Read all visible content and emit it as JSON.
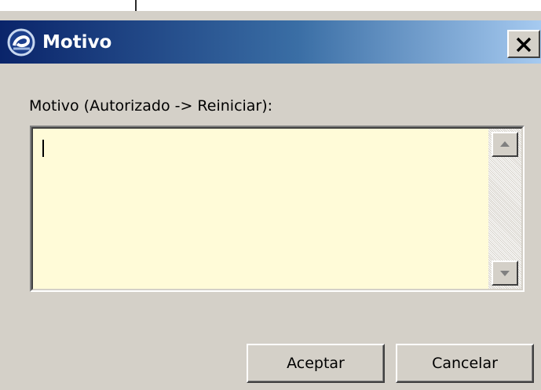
{
  "dialog": {
    "title": "Motivo",
    "icon": "app-logo-icon",
    "close_icon": "close-icon"
  },
  "form": {
    "label": "Motivo (Autorizado -> Reiniciar):",
    "textarea_value": "",
    "textarea_bg": "#fffbd8"
  },
  "buttons": {
    "accept_label": "Aceptar",
    "cancel_label": "Cancelar"
  },
  "colors": {
    "titlebar_start": "#0a246a",
    "titlebar_end": "#a6caf0",
    "window_bg": "#d4d0c8"
  }
}
